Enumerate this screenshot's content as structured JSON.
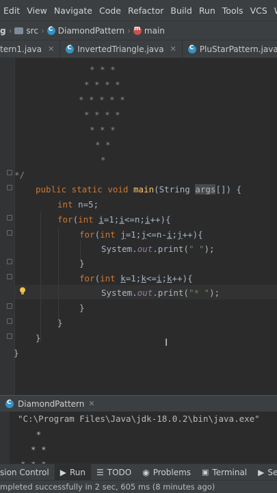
{
  "menu": [
    "Edit",
    "View",
    "Navigate",
    "Code",
    "Refactor",
    "Build",
    "Run",
    "Tools",
    "VCS",
    "Wind"
  ],
  "breadcrumb": {
    "root": "g",
    "src": "src",
    "class": "DiamondPattern",
    "method": "main"
  },
  "tabs": [
    {
      "label": "tern1.java",
      "icon": "none"
    },
    {
      "label": "InvertedTriangle.java",
      "icon": "class-icon"
    },
    {
      "label": "PluStarPattern.java",
      "icon": "class-icon"
    }
  ],
  "code": {
    "comment_rows": [
      "* * *",
      "* * * *",
      "* * * * *",
      "* * * *",
      "* * *",
      "* *",
      "*"
    ],
    "comment_end": "*/",
    "line_main": {
      "kw": "public static void ",
      "fn": "main",
      "p1": "(String ",
      "arg": "args",
      "p2": "[]) {"
    },
    "line_n": {
      "kw": "int ",
      "rest": "n=5;"
    },
    "line_for_i": {
      "kw1": "for",
      "p": "(",
      "kw2": "int ",
      "i1": "i",
      "a": "=1;",
      "i2": "i",
      "b": "<=n;",
      "i3": "i",
      "c": "++){"
    },
    "line_for_j": {
      "kw1": "for",
      "p": "(",
      "kw2": "int ",
      "j1": "j",
      "a": "=1;",
      "j2": "j",
      "b": "<=n-",
      "i": "i",
      "c": ";",
      "j3": "j",
      "d": "++){"
    },
    "line_print_space": {
      "a": "System.",
      "fld": "out",
      "b": ".print(",
      "str": "\" \"",
      "c": ");"
    },
    "brace_close": "}",
    "line_for_k": {
      "kw1": "for",
      "p": "(",
      "kw2": "int ",
      "k1": "k",
      "a": "=1;",
      "k2": "k",
      "b": "<=",
      "i": "i",
      "c": ";",
      "k3": "k",
      "d": "++){"
    },
    "line_print_star": {
      "a": "System.",
      "fld": "out",
      "b": ".print(",
      "str": "\"* \"",
      "c": ");"
    }
  },
  "run": {
    "tab_label": "DiamondPattern",
    "cmd": "\"C:\\Program Files\\Java\\jdk-18.0.2\\bin\\java.exe\"",
    "out1": "   *",
    "out2": "  * *",
    "out3": "* * *"
  },
  "toolwindows": [
    "sion Control",
    "Run",
    "TODO",
    "Problems",
    "Terminal",
    "Se"
  ],
  "status": "mpleted successfully in 2 sec, 605 ms (8 minutes ago)",
  "colors": {
    "keyword": "#cc7832",
    "function": "#ffc66d",
    "string": "#6a8759",
    "field": "#9876aa",
    "comment": "#8a8a8a"
  }
}
